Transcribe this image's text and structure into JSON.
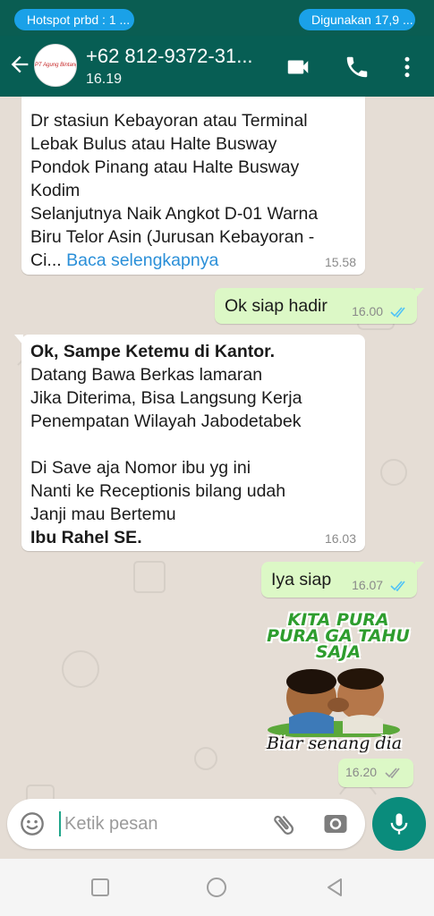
{
  "status_bar": {
    "hotspot_text": "Hotspot prbd : 1 ...",
    "usage_text": "Digunakan 17,9 ..."
  },
  "header": {
    "avatar_text": "PT Agung Bintang Mitra",
    "contact_name": "+62 812-9372-31...",
    "last_seen": "16.19",
    "icons": [
      "back-arrow-icon",
      "video-call-icon",
      "phone-icon",
      "more-vert-icon"
    ]
  },
  "messages": [
    {
      "direction": "in",
      "lines": [
        "Dr stasiun Kebayoran atau Terminal",
        "Lebak Bulus atau Halte Busway",
        "Pondok Pinang atau Halte Busway",
        "Kodim",
        "Selanjutnya Naik Angkot D-01 Warna",
        "Biru Telor Asin (Jurusan Kebayoran -"
      ],
      "truncated_prefix": "Ci...",
      "read_more": "Baca selengkapnya",
      "time": "15.58"
    },
    {
      "direction": "out",
      "text": "Ok siap hadir",
      "time": "16.00",
      "status": "read"
    },
    {
      "direction": "in",
      "lines": [
        "Ok, Sampe Ketemu di Kantor.",
        "Datang Bawa Berkas lamaran",
        "Jika Diterima, Bisa Langsung Kerja",
        "Penempatan Wilayah Jabodetabek",
        "",
        "Di Save aja Nomor ibu yg ini",
        "Nanti ke Receptionis bilang udah",
        "Janji mau Bertemu",
        "Ibu Rahel SE."
      ],
      "time": "16.03"
    },
    {
      "direction": "out",
      "text": "Iya siap",
      "time": "16.07",
      "status": "read"
    },
    {
      "direction": "out",
      "type": "sticker",
      "sticker_top_text_1": "KITA PURA",
      "sticker_top_text_2": "PURA GA TAHU",
      "sticker_top_text_3": "SAJA",
      "sticker_bottom_text": "Biar senang dia",
      "time": "16.20",
      "status": "delivered"
    }
  ],
  "composer": {
    "placeholder": "Ketik pesan",
    "icons": [
      "emoji-icon",
      "attach-icon",
      "camera-icon",
      "mic-icon"
    ]
  },
  "colors": {
    "header": "#075e54",
    "status_bar": "#0a5d52",
    "chat_bg": "#e5ddd5",
    "outgoing_bubble": "#dcf8c6",
    "incoming_bubble": "#ffffff",
    "read_ticks": "#4fc3f7",
    "link": "#2a8fd8",
    "mic_button": "#0a8c7c",
    "status_pill": "#1aa1e8"
  }
}
